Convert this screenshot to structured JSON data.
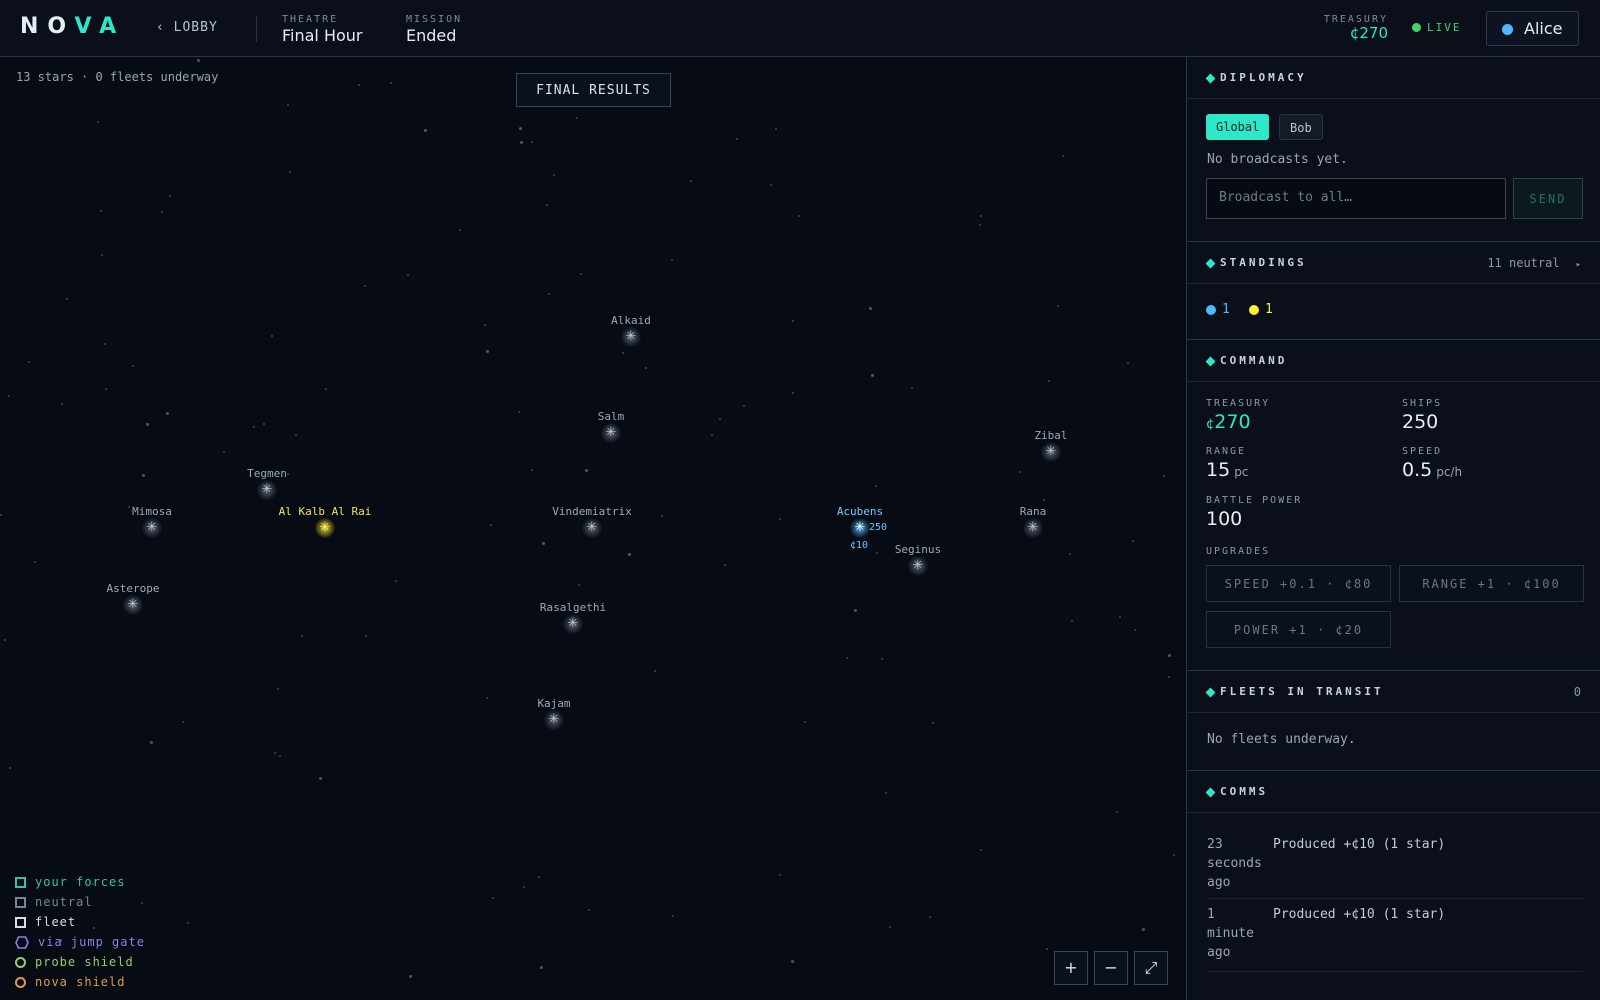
{
  "app": {
    "logo_first": "NO",
    "logo_second": "VA"
  },
  "header": {
    "back_label": "‹ LOBBY",
    "theatre_label": "THEATRE",
    "theatre_value": "Final Hour",
    "mission_label": "MISSION",
    "mission_value": "Ended",
    "treasury_label": "TREASURY",
    "treasury_value": "¢270",
    "live_label": "LIVE",
    "user_name": "Alice"
  },
  "map": {
    "summary": "13 stars · 0 fleets underway",
    "final_button": "FINAL RESULTS",
    "stars": [
      {
        "name": "Alkaid",
        "owner": "neutral"
      },
      {
        "name": "Salm",
        "owner": "neutral"
      },
      {
        "name": "Zibal",
        "owner": "neutral"
      },
      {
        "name": "Tegmen",
        "owner": "neutral"
      },
      {
        "name": "Mimosa",
        "owner": "neutral"
      },
      {
        "name": "Al Kalb Al Rai",
        "owner": "yellow"
      },
      {
        "name": "Vindemiatrix",
        "owner": "neutral"
      },
      {
        "name": "Acubens",
        "owner": "blue",
        "ships": "250",
        "income": "¢10"
      },
      {
        "name": "Rana",
        "owner": "neutral"
      },
      {
        "name": "Seginus",
        "owner": "neutral"
      },
      {
        "name": "Asterope",
        "owner": "neutral"
      },
      {
        "name": "Rasalgethi",
        "owner": "neutral"
      },
      {
        "name": "Kajam",
        "owner": "neutral"
      }
    ],
    "legend": [
      {
        "label": "your forces",
        "color": "#2ec4b0",
        "shape": "square"
      },
      {
        "label": "neutral",
        "color": "#7a8593",
        "shape": "square"
      },
      {
        "label": "fleet",
        "color": "#d8dee6",
        "shape": "square"
      },
      {
        "label": "via jump gate",
        "color": "#8f7ee8",
        "shape": "hexagon"
      },
      {
        "label": "probe shield",
        "color": "#8fd26a",
        "shape": "circle"
      },
      {
        "label": "nova shield",
        "color": "#e09a4e",
        "shape": "circle"
      }
    ],
    "zoom_in": "+",
    "zoom_out": "−",
    "fit": "⤢"
  },
  "diplomacy": {
    "title": "DIPLOMACY",
    "tabs": [
      "Global",
      "Bob"
    ],
    "empty_text": "No broadcasts yet.",
    "input_placeholder": "Broadcast to all…",
    "send_label": "SEND"
  },
  "standings": {
    "title": "STANDINGS",
    "neutral_count": "11 neutral",
    "arrow": "▸",
    "entries": [
      {
        "value": "1",
        "color": "#4db8ff"
      },
      {
        "value": "1",
        "color": "#ffee33"
      }
    ]
  },
  "command": {
    "title": "COMMAND",
    "treasury_label": "TREASURY",
    "treasury_symbol": "¢",
    "treasury_value": "270",
    "ships_label": "SHIPS",
    "ships_value": "250",
    "range_label": "RANGE",
    "range_value": "15",
    "range_unit": "pc",
    "speed_label": "SPEED",
    "speed_value": "0.5",
    "speed_unit": "pc/h",
    "power_label": "BATTLE POWER",
    "power_value": "100",
    "upgrades_label": "UPGRADES",
    "upgrades": [
      "SPEED +0.1 · ¢80",
      "RANGE +1 · ¢100",
      "POWER +1 · ¢20"
    ]
  },
  "fleets": {
    "title": "FLEETS IN TRANSIT",
    "count": "0",
    "empty_text": "No fleets underway."
  },
  "comms": {
    "title": "COMMS",
    "entries": [
      {
        "time": "23 seconds ago",
        "message": "Produced +¢10 (1 star)"
      },
      {
        "time": "1 minute ago",
        "message": "Produced +¢10 (1 star)"
      }
    ]
  },
  "colors": {
    "accent": "#2ee6c8",
    "player": "#4db8ff",
    "rival": "#ffee33",
    "live": "#3fd46d"
  }
}
